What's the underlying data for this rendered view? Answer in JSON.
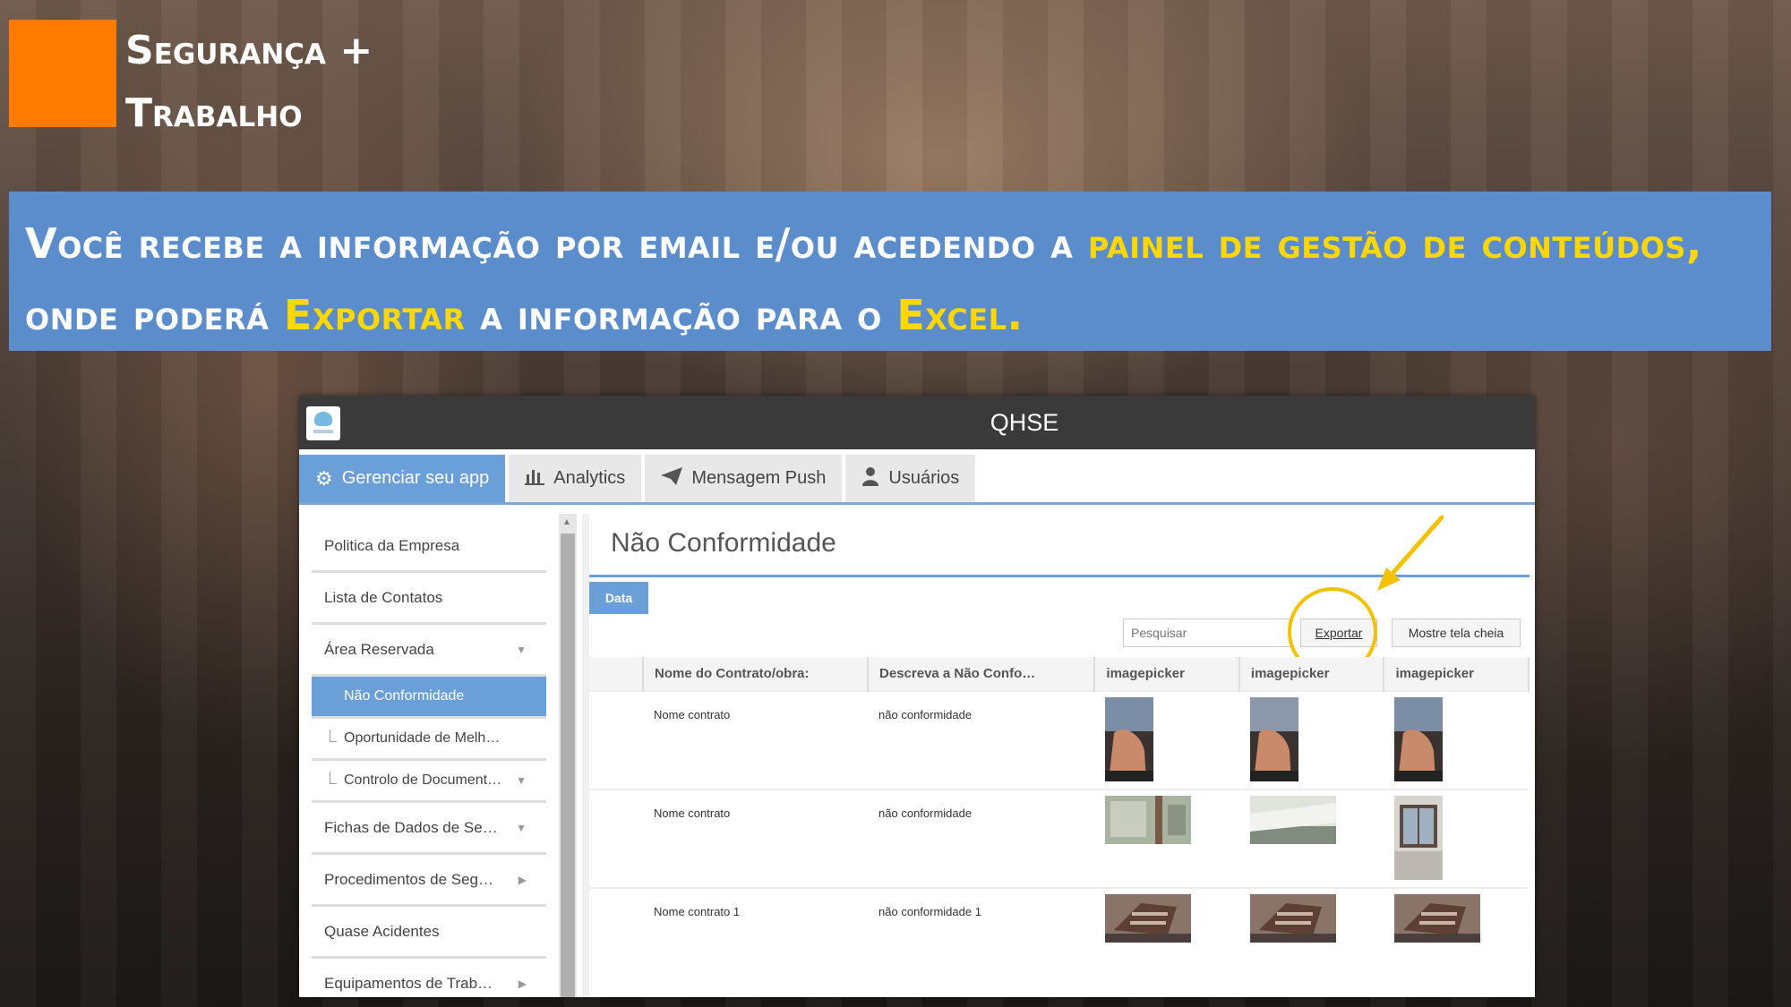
{
  "logo": {
    "line1": "Segurança +",
    "line2": "Trabalho",
    "color": "#ff7a00"
  },
  "banner": {
    "part1": "Você recebe a informação por email e/ou acedendo a ",
    "part2": "painel de gestão de conteúdos,",
    "part3": " onde poderá ",
    "part4": "Exportar",
    "part5": " a informação para o ",
    "part6": "Excel.",
    "background": "#5b8ccc",
    "highlight_color": "#ffd700"
  },
  "app": {
    "title": "QHSE",
    "tabs": [
      {
        "label": "Gerenciar seu app",
        "icon": "gear-icon"
      },
      {
        "label": "Analytics",
        "icon": "bar-chart-icon"
      },
      {
        "label": "Mensagem Push",
        "icon": "paper-plane-icon"
      },
      {
        "label": "Usuários",
        "icon": "user-icon"
      }
    ],
    "sidebar": [
      {
        "label": "Politica da Empresa"
      },
      {
        "label": "Lista de Contatos"
      },
      {
        "label": "Área Reservada"
      },
      {
        "label": "Não Conformidade"
      },
      {
        "label": "Oportunidade de Melh…"
      },
      {
        "label": "Controlo de Document…"
      },
      {
        "label": "Fichas de Dados de Se…"
      },
      {
        "label": "Procedimentos de Seg…"
      },
      {
        "label": "Quase Acidentes"
      },
      {
        "label": "Equipamentos de Trab…"
      }
    ],
    "main": {
      "title": "Não Conformidade",
      "data_button": "Data",
      "search_placeholder": "Pesquisar",
      "export_button": "Exportar",
      "fullscreen_button": "Mostre tela cheia",
      "columns": [
        "",
        "Nome do Contrato/obra:",
        "Descreva a Não Confo…",
        "imagepicker",
        "imagepicker",
        "imagepicker"
      ],
      "rows": [
        {
          "contrato": "Nome contrato",
          "descricao": "não conformidade"
        },
        {
          "contrato": "Nome contrato",
          "descricao": "não conformidade"
        },
        {
          "contrato": "Nome contrato 1",
          "descricao": "não conformidade 1"
        }
      ]
    },
    "accent": "#6a9fd8"
  }
}
